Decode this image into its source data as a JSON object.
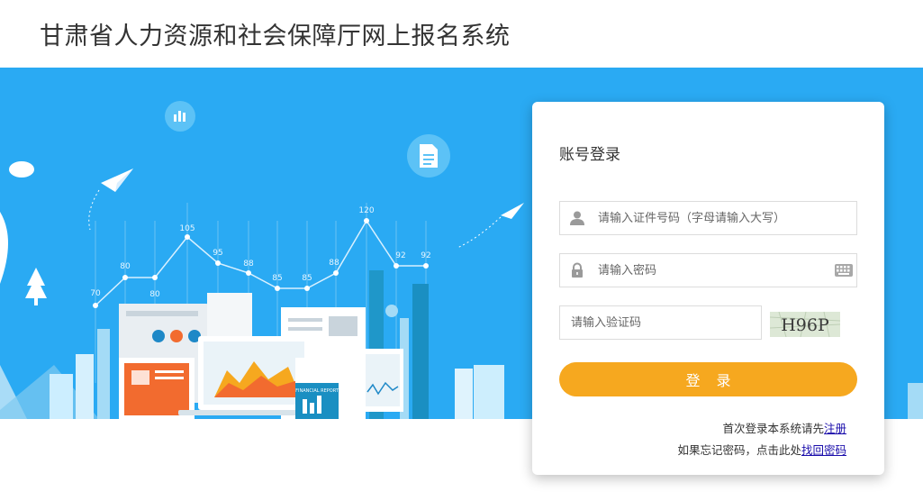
{
  "header": {
    "title": "甘肃省人力资源和社会保障厅网上报名系统"
  },
  "illustration": {
    "chart_values": [
      "70",
      "80",
      "80",
      "105",
      "95",
      "88",
      "85",
      "85",
      "88",
      "120",
      "92",
      "92"
    ],
    "report_label": "FINANCIAL REPORT"
  },
  "login": {
    "title": "账号登录",
    "id_placeholder": "请输入证件号码（字母请输入大写）",
    "password_placeholder": "请输入密码",
    "captcha_placeholder": "请输入验证码",
    "captcha_text": "H96P",
    "submit_label": "登录",
    "register_prefix": "首次登录本系统请先",
    "register_link": "注册",
    "forgot_prefix": "如果忘记密码，点击此处",
    "forgot_link": "找回密码"
  },
  "colors": {
    "banner_bg": "#2aaaf3",
    "button": "#f6a81f",
    "link": "#1a0dab"
  },
  "icons": {
    "id_field": "user-icon",
    "password_field": "lock-icon",
    "password_action": "keyboard-icon"
  }
}
